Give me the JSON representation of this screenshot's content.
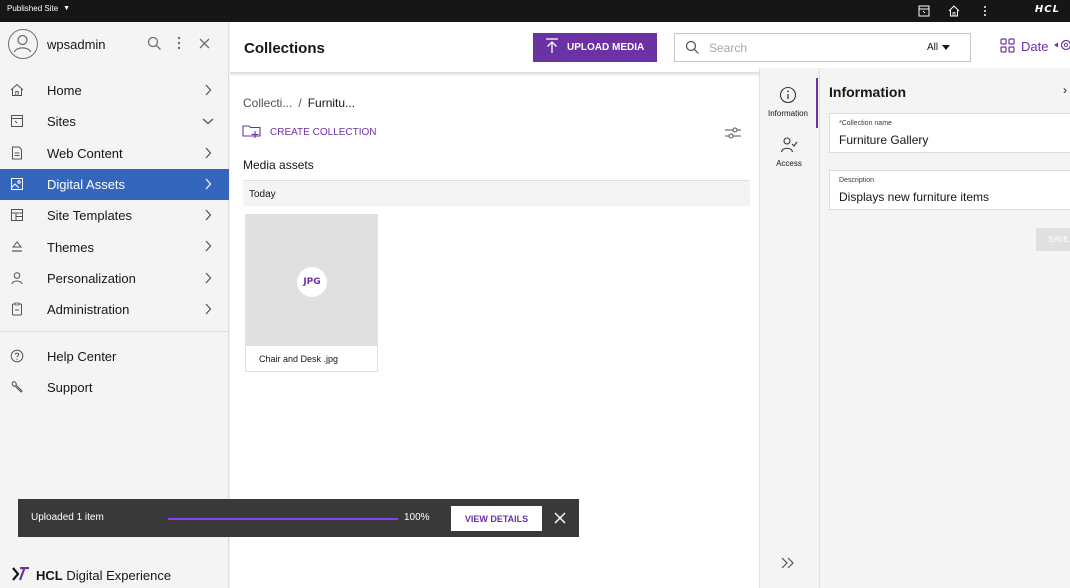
{
  "topbar": {
    "site_label": "Published Site",
    "brand": "HCL",
    "icons": [
      "panel-icon",
      "home-icon",
      "overflow-icon"
    ]
  },
  "sidebar": {
    "username": "wpsadmin",
    "nav_items": [
      {
        "label": "Home",
        "icon": "home-icon",
        "chevron": "›"
      },
      {
        "label": "Sites",
        "icon": "sites-icon",
        "chevron": "⌄"
      },
      {
        "label": "Web Content",
        "icon": "document-icon",
        "chevron": "›"
      },
      {
        "label": "Digital Assets",
        "icon": "image-icon",
        "chevron": "›",
        "active": true
      },
      {
        "label": "Site Templates",
        "icon": "template-icon",
        "chevron": "›"
      },
      {
        "label": "Themes",
        "icon": "paint-icon",
        "chevron": "›"
      },
      {
        "label": "Personalization",
        "icon": "user-icon",
        "chevron": "›"
      },
      {
        "label": "Administration",
        "icon": "clipboard-icon",
        "chevron": "›"
      }
    ],
    "secondary_items": [
      {
        "label": "Help Center",
        "icon": "help-icon"
      },
      {
        "label": "Support",
        "icon": "wrench-icon"
      }
    ],
    "brand_bold": "HCL",
    "brand_rest": " Digital Experience"
  },
  "header": {
    "title": "Collections",
    "upload_label": "UPLOAD MEDIA",
    "search_placeholder": "Search",
    "filter_value": "All",
    "sort_label": "Date"
  },
  "content": {
    "breadcrumb": [
      "Collecti...",
      "/",
      "Furnitu..."
    ],
    "create_collection_label": "CREATE COLLECTION",
    "section_title": "Media assets",
    "group_label": "Today",
    "assets": [
      {
        "name": "Chair and Desk .jpg",
        "type_badge": "JPG"
      }
    ]
  },
  "rail": {
    "tabs": [
      {
        "label": "Information",
        "icon": "info-icon",
        "active": true
      },
      {
        "label": "Access",
        "icon": "access-icon"
      }
    ]
  },
  "info_panel": {
    "title": "Information",
    "close_glyph": "›",
    "collection_name_label": "*Collection name",
    "collection_name_value": "Furniture Gallery",
    "description_label": "Description",
    "description_value": "Displays new furniture items",
    "save_label": "SAVE"
  },
  "toast": {
    "message": "Uploaded 1 item",
    "progress_percent": 100,
    "progress_label": "100%",
    "action_label": "VIEW DETAILS"
  },
  "colors": {
    "accent": "#6d31a6",
    "active_nav": "#3466bd",
    "topbar": "#161616",
    "toast": "#393939"
  }
}
